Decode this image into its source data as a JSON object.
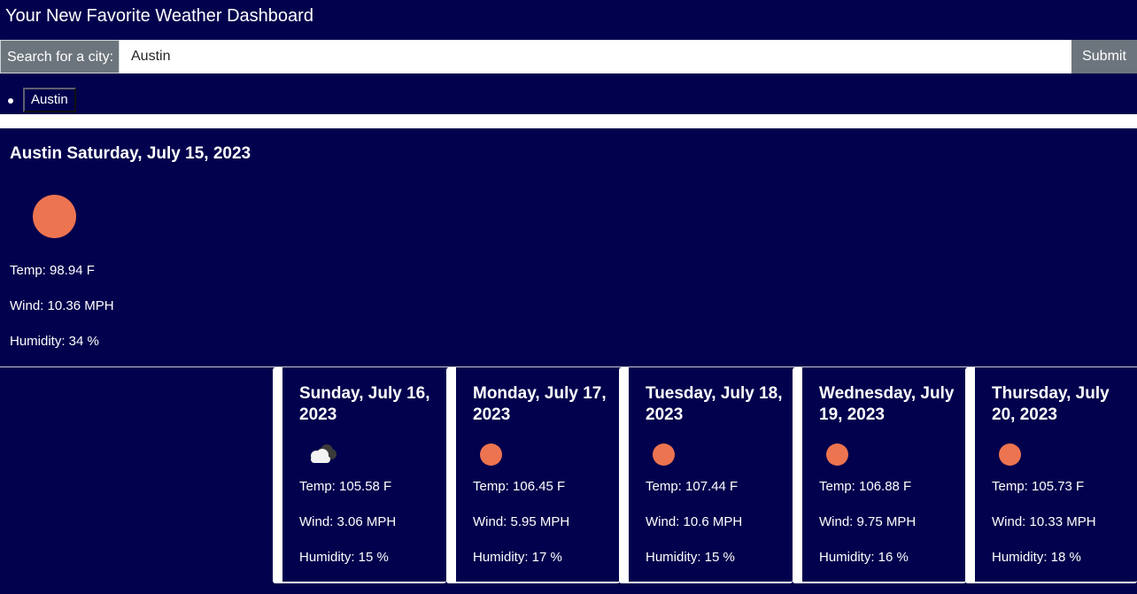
{
  "header": {
    "title": "Your New Favorite Weather Dashboard"
  },
  "search": {
    "label": "Search for a city:",
    "value": "Austin",
    "submit_label": "Submit"
  },
  "history": [
    {
      "label": "Austin"
    }
  ],
  "current": {
    "heading": "Austin Saturday, July 15, 2023",
    "icon": "sun-icon",
    "temp": "Temp: 98.94 F",
    "wind": "Wind: 10.36 MPH",
    "humidity": "Humidity: 34 %"
  },
  "forecast": [
    {
      "date": "Sunday, July 16, 2023",
      "icon": "cloud-icon",
      "temp": "Temp: 105.58 F",
      "wind": "Wind: 3.06 MPH",
      "humidity": "Humidity: 15 %"
    },
    {
      "date": "Monday, July 17, 2023",
      "icon": "sun-icon",
      "temp": "Temp: 106.45 F",
      "wind": "Wind: 5.95 MPH",
      "humidity": "Humidity: 17 %"
    },
    {
      "date": "Tuesday, July 18, 2023",
      "icon": "sun-icon",
      "temp": "Temp: 107.44 F",
      "wind": "Wind: 10.6 MPH",
      "humidity": "Humidity: 15 %"
    },
    {
      "date": "Wednesday, July 19, 2023",
      "icon": "sun-icon",
      "temp": "Temp: 106.88 F",
      "wind": "Wind: 9.75 MPH",
      "humidity": "Humidity: 16 %"
    },
    {
      "date": "Thursday, July 20, 2023",
      "icon": "sun-icon",
      "temp": "Temp: 105.73 F",
      "wind": "Wind: 10.33 MPH",
      "humidity": "Humidity: 18 %"
    }
  ],
  "colors": {
    "background": "#02014d",
    "sun": "#ed7450",
    "button_gray": "#6c757d"
  }
}
